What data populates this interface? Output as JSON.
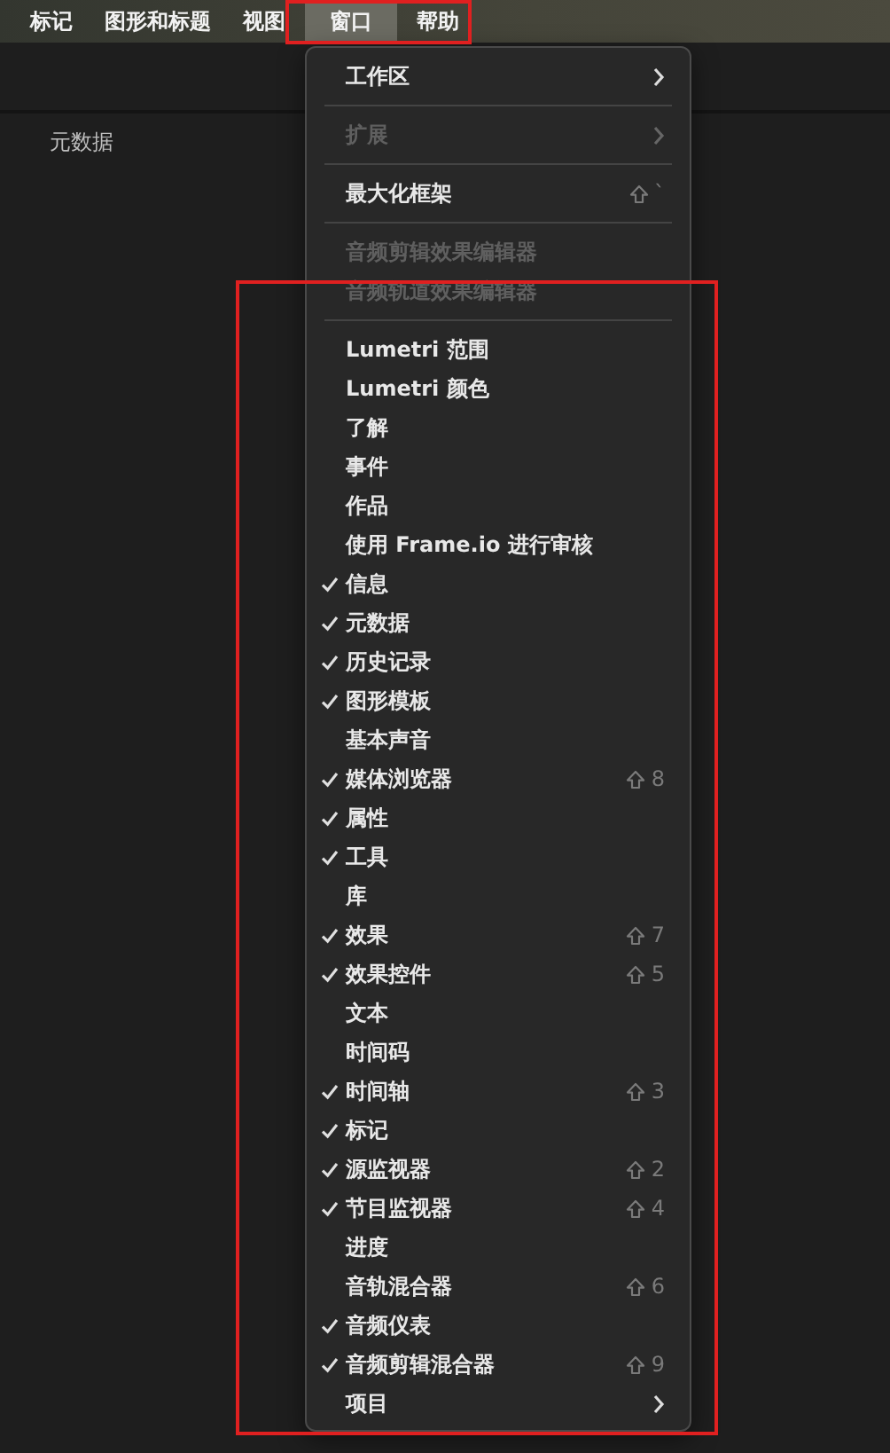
{
  "menubar": [
    {
      "label": "标记",
      "selected": false
    },
    {
      "label": "图形和标题",
      "selected": false
    },
    {
      "label": "视图",
      "selected": false
    },
    {
      "label": "窗口",
      "selected": true
    },
    {
      "label": "帮助",
      "selected": false
    }
  ],
  "panel": {
    "title": "元数据"
  },
  "menu": [
    {
      "kind": "item",
      "label": "工作区",
      "submenu": true,
      "disabled": false
    },
    {
      "kind": "separator"
    },
    {
      "kind": "item",
      "label": "扩展",
      "submenu": true,
      "disabled": true
    },
    {
      "kind": "separator"
    },
    {
      "kind": "item",
      "label": "最大化框架",
      "disabled": false,
      "shortcut": "`"
    },
    {
      "kind": "separator"
    },
    {
      "kind": "item",
      "label": "音频剪辑效果编辑器",
      "disabled": true
    },
    {
      "kind": "item",
      "label": "音频轨道效果编辑器",
      "disabled": true
    },
    {
      "kind": "separator"
    },
    {
      "kind": "item",
      "label": "Lumetri 范围",
      "checked": false
    },
    {
      "kind": "item",
      "label": "Lumetri 颜色",
      "checked": false
    },
    {
      "kind": "item",
      "label": "了解",
      "checked": false
    },
    {
      "kind": "item",
      "label": "事件",
      "checked": false
    },
    {
      "kind": "item",
      "label": "作品",
      "checked": false
    },
    {
      "kind": "item",
      "label": "使用 Frame.io 进行审核",
      "checked": false
    },
    {
      "kind": "item",
      "label": "信息",
      "checked": true
    },
    {
      "kind": "item",
      "label": "元数据",
      "checked": true
    },
    {
      "kind": "item",
      "label": "历史记录",
      "checked": true
    },
    {
      "kind": "item",
      "label": "图形模板",
      "checked": true
    },
    {
      "kind": "item",
      "label": "基本声音",
      "checked": false
    },
    {
      "kind": "item",
      "label": "媒体浏览器",
      "checked": true,
      "shortcut": "8"
    },
    {
      "kind": "item",
      "label": "属性",
      "checked": true
    },
    {
      "kind": "item",
      "label": "工具",
      "checked": true
    },
    {
      "kind": "item",
      "label": "库",
      "checked": false
    },
    {
      "kind": "item",
      "label": "效果",
      "checked": true,
      "shortcut": "7"
    },
    {
      "kind": "item",
      "label": "效果控件",
      "checked": true,
      "shortcut": "5"
    },
    {
      "kind": "item",
      "label": "文本",
      "checked": false
    },
    {
      "kind": "item",
      "label": "时间码",
      "checked": false
    },
    {
      "kind": "item",
      "label": "时间轴",
      "checked": true,
      "shortcut": "3"
    },
    {
      "kind": "item",
      "label": "标记",
      "checked": true
    },
    {
      "kind": "item",
      "label": "源监视器",
      "checked": true,
      "shortcut": "2"
    },
    {
      "kind": "item",
      "label": "节目监视器",
      "checked": true,
      "shortcut": "4"
    },
    {
      "kind": "item",
      "label": "进度",
      "checked": false
    },
    {
      "kind": "item",
      "label": "音轨混合器",
      "checked": false,
      "shortcut": "6"
    },
    {
      "kind": "item",
      "label": "音频仪表",
      "checked": true
    },
    {
      "kind": "item",
      "label": "音频剪辑混合器",
      "checked": true,
      "shortcut": "9"
    },
    {
      "kind": "item",
      "label": "项目",
      "submenu": true,
      "checked": false
    }
  ]
}
